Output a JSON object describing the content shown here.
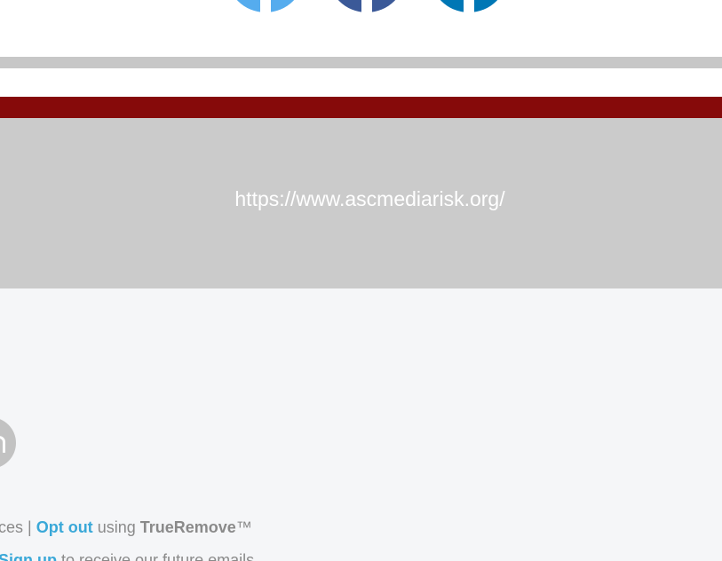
{
  "social": {
    "icons": [
      {
        "name": "twitter-icon",
        "color": "#55acee"
      },
      {
        "name": "facebook-icon",
        "color": "#3b5998"
      },
      {
        "name": "linkedin-icon",
        "color": "#0077b5"
      }
    ]
  },
  "colors": {
    "divider": "#c7c7c7",
    "brand_red": "#860a0a",
    "url_block": "#cbcbcb",
    "footer_bg": "#f5f6f8",
    "link": "#3aa8d8"
  },
  "url_block": {
    "url": "https://www.ascmediarisk.org/"
  },
  "footer": {
    "line1": {
      "prefix": "ces | ",
      "opt_out_link": "Opt out",
      "middle": " using ",
      "brand": "TrueRemove",
      "trademark": "™"
    },
    "line2": {
      "signup_link": "Sign up",
      "suffix": " to receive our future emails"
    }
  }
}
